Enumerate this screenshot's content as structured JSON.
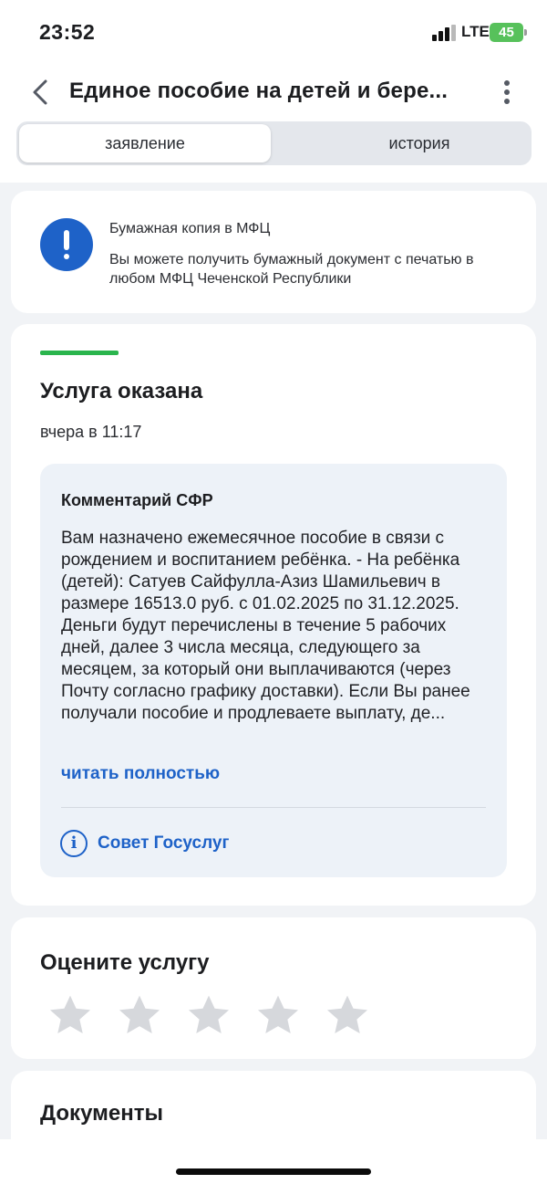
{
  "status_bar": {
    "time": "23:52",
    "network": "LTE",
    "battery": "45"
  },
  "header": {
    "title": "Единое пособие на детей и бере..."
  },
  "tabs": [
    {
      "label": "заявление",
      "active": true
    },
    {
      "label": "история",
      "active": false
    }
  ],
  "notice": {
    "title": "Бумажная копия в МФЦ",
    "text": "Вы можете получить бумажный документ с печатью в любом МФЦ Чеченской Республики"
  },
  "status": {
    "title": "Услуга оказана",
    "date": "вчера в 11:17",
    "accent_color": "#2ab54d"
  },
  "comment": {
    "title": "Комментарий СФР",
    "text": "Вам назначено ежемесячное пособие в связи с рождением и воспитанием ребёнка. - На ребёнка (детей): Сатуев Сайфулла-Азиз Шамильевич в размере 16513.0 руб. с 01.02.2025 по 31.12.2025. Деньги будут перечислены в течение 5 рабочих дней, далее 3 числа месяца, следующего за месяцем, за который они выплачиваются (через Почту согласно графику доставки). Если Вы ранее получали пособие и продлеваете выплату, де...",
    "read_more": "читать полностью",
    "tip_label": "Совет Госуслуг"
  },
  "rating": {
    "title": "Оцените услугу",
    "max_stars": 5,
    "selected": 0
  },
  "documents": {
    "title": "Документы"
  },
  "colors": {
    "primary": "#1e62c8",
    "star_inactive": "#d6d8dc",
    "background": "#f1f3f6"
  }
}
